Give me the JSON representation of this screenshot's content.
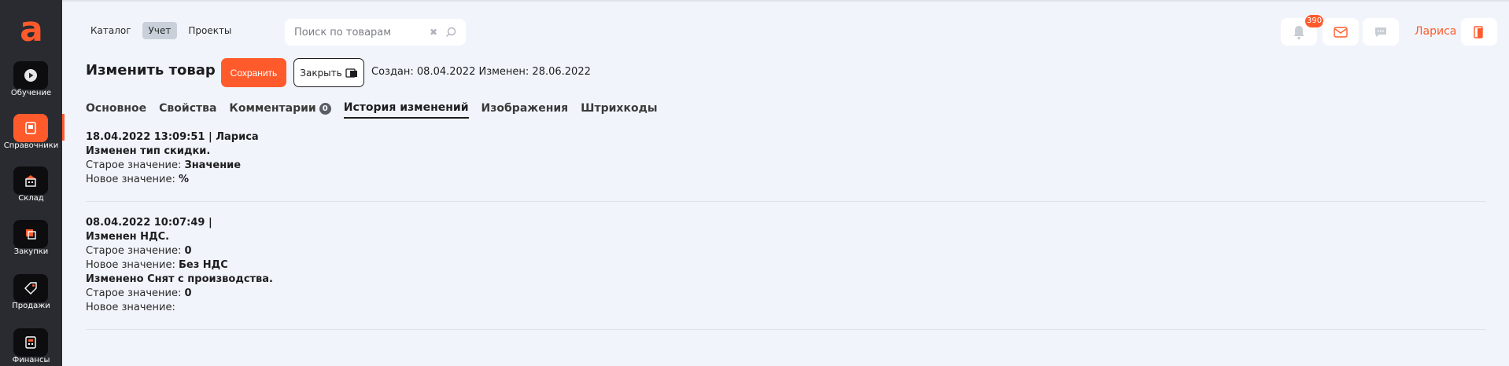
{
  "sidebar": {
    "logo": "a",
    "items": [
      {
        "label": "Обучение",
        "icon": "play-icon"
      },
      {
        "label": "Справочники",
        "icon": "book-icon",
        "active": true
      },
      {
        "label": "Склад",
        "icon": "warehouse-icon"
      },
      {
        "label": "Закупки",
        "icon": "purchases-icon"
      },
      {
        "label": "Продажи",
        "icon": "tag-icon"
      },
      {
        "label": "Финансы",
        "icon": "finance-icon"
      }
    ]
  },
  "topnav": {
    "catalog": "Каталог",
    "accounting": "Учет",
    "projects": "Проекты"
  },
  "search": {
    "placeholder": "Поиск по товарам"
  },
  "header_right": {
    "notifications_count": "390",
    "user_name": "Лариса"
  },
  "page": {
    "title": "Изменить товар",
    "save_label": "Сохранить",
    "close_label": "Закрыть",
    "dates": "Создан: 08.04.2022 Изменен: 28.06.2022"
  },
  "tabs": {
    "main": "Основное",
    "properties": "Свойства",
    "comments": "Комментарии",
    "comments_count": "0",
    "history": "История изменений",
    "images": "Изображения",
    "barcodes": "Штрихкоды"
  },
  "history": [
    {
      "header": "18.04.2022 13:09:51 | Лариса",
      "change1": "Изменен тип скидки.",
      "old_label": "Старое значение: ",
      "old_value": "Значение",
      "new_label": "Новое значение: ",
      "new_value": "%"
    },
    {
      "header": "08.04.2022 10:07:49 |",
      "change1": "Изменен НДС.",
      "old_label": "Старое значение: ",
      "old_value": "0",
      "new_label": "Новое значение: ",
      "new_value": "Без НДС",
      "change2": "Изменено Снят с производства.",
      "old_label2": "Старое значение: ",
      "old_value2": "0",
      "new_label2": "Новое значение:"
    }
  ],
  "colors": {
    "accent": "#ff5a2c",
    "sidebar": "#2a2b30",
    "background": "#f1f5fb"
  }
}
